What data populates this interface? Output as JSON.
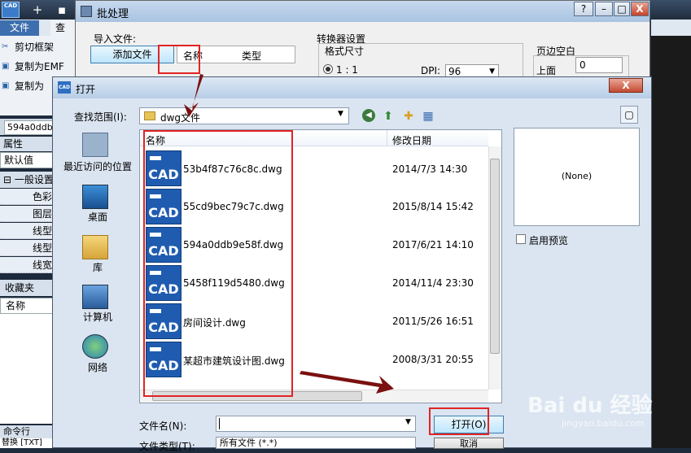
{
  "app": {
    "logo_text": "CAD",
    "tabs": [
      "文件",
      "查看"
    ],
    "ribbon_items": [
      "剪切框架",
      "复制为EMF",
      "复制为"
    ],
    "side_tab": "594a0ddb",
    "props_header": "属性",
    "props_default": "默认值",
    "props_general": "一般设置",
    "props_rows": [
      "色彩",
      "图层",
      "线型",
      "线型",
      "线宽"
    ],
    "fav_header": "收藏夹",
    "fav_name": "名称",
    "cmd_header": "命令行",
    "cmd_text": "替换 [TXT]"
  },
  "batch": {
    "title": "批处理",
    "import_label": "导入文件:",
    "add_file_button": "添加文件",
    "col_name": "名称",
    "col_type": "类型",
    "converter_label": "转换器设置",
    "format_label": "格式尺寸",
    "radio_11": "1 : 1",
    "dpi_label": "DPI:",
    "dpi_value": "96",
    "margin_label": "页边空白",
    "top_label": "上面",
    "top_value": "0",
    "win_controls": [
      "?",
      "–",
      "□",
      "X"
    ]
  },
  "open": {
    "title": "打开",
    "icon_text": "CAD",
    "close": "X",
    "look_in_label": "查找范围(I):",
    "look_in_value": "dwg文件",
    "places": [
      {
        "label": "最近访问的位置",
        "icon": "recent-places-icon"
      },
      {
        "label": "桌面",
        "icon": "desktop-icon"
      },
      {
        "label": "库",
        "icon": "library-icon"
      },
      {
        "label": "计算机",
        "icon": "computer-icon"
      },
      {
        "label": "网络",
        "icon": "network-icon"
      }
    ],
    "col_name": "名称",
    "col_date": "修改日期",
    "files": [
      {
        "name": "53b4f87c76c8c.dwg",
        "date": "2014/7/3 14:30"
      },
      {
        "name": "55cd9bec79c7c.dwg",
        "date": "2015/8/14 15:42"
      },
      {
        "name": "594a0ddb9e58f.dwg",
        "date": "2017/6/21 14:10"
      },
      {
        "name": "5458f119d5480.dwg",
        "date": "2014/11/4 23:30"
      },
      {
        "name": "房间设计.dwg",
        "date": "2011/5/26 16:51"
      },
      {
        "name": "某超市建筑设计图.dwg",
        "date": "2008/3/31 20:55"
      }
    ],
    "file_icon_text": "CAD",
    "preview_none": "(None)",
    "enable_preview": "启用预览",
    "file_name_label": "文件名(N):",
    "file_name_value": "",
    "file_type_label": "文件类型(T):",
    "file_type_value": "所有文件 (*.*)",
    "open_button": "打开(O)",
    "cancel_button": "取消"
  },
  "watermark": {
    "brand": "Bai du 经验",
    "url": "jingyan.baidu.com"
  },
  "colors": {
    "annotation_red": "#e02424",
    "arrow_dark_red": "#7a1010",
    "cad_blue": "#1f5cb0"
  }
}
